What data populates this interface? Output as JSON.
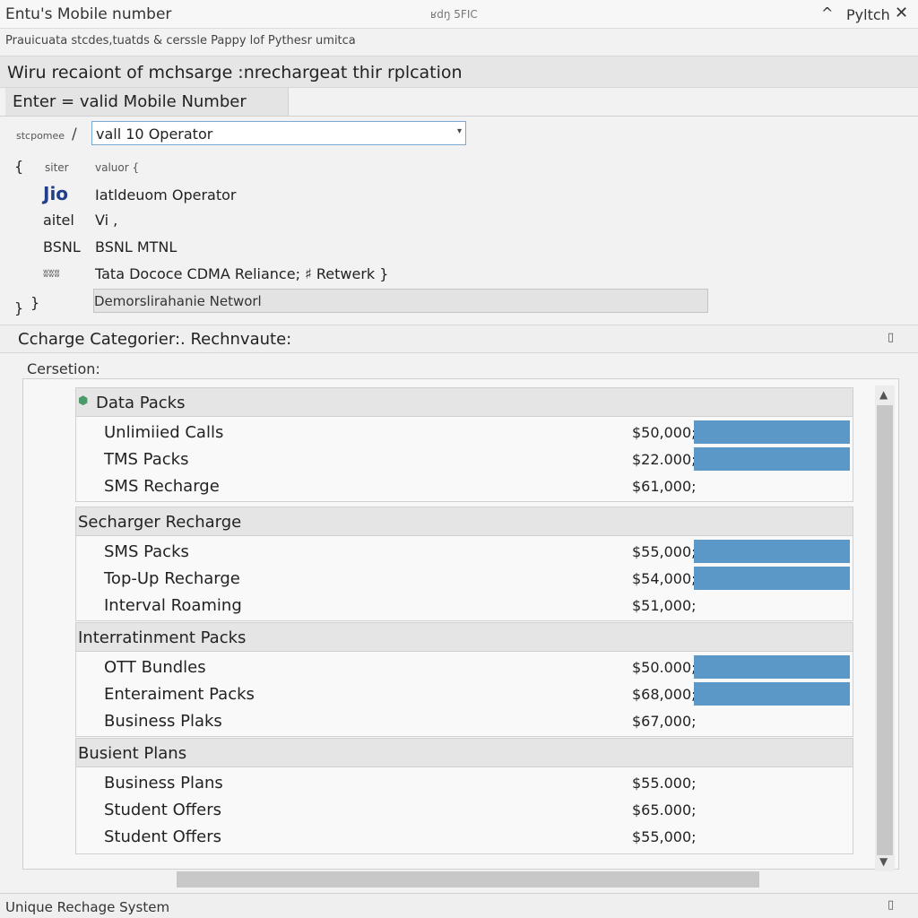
{
  "window": {
    "title": "Entu's Mobile number",
    "center_text": "ʁdŋ 5FIC",
    "minimize_glyph": "^",
    "app_name": "Pyltch",
    "close_glyph": "✕"
  },
  "subtitle": "Prauicuata stcdes,tuatds & cerssle Pappy lof Pythesr umitca",
  "heading": "Wiru recaiont of mchsarge :nrechargeat thir rplcation",
  "mobile_tab": "Enter = valid Mobile Number",
  "operator": {
    "label": "stcpomee",
    "slash": "/",
    "value": "vall 10 Operator",
    "caret": "▾"
  },
  "tree": {
    "open_brace": "{",
    "sub_open_left": "siter",
    "sub_open_right": "valuor {",
    "rows": [
      {
        "key": "Jio",
        "value": "Iatldeuom Operator"
      },
      {
        "key": "aitel",
        "value": "Vi ,"
      },
      {
        "key": "BSNL",
        "value": "BSNL MTNL"
      },
      {
        "key": "ʬʬʬ",
        "value": "Tata Dococe CDMA Reliance; ♯ Retwerk }"
      }
    ],
    "network_box": "Demorslirahanie Networl",
    "close_left": "}",
    "close_right": "}"
  },
  "category_header": "Ccharge Categorier:. Rechnvaute:",
  "section_label": "Cersetion:",
  "groups": [
    {
      "title": "Data Packs",
      "icon": "⬢",
      "items": [
        {
          "name": "Unlimiied Calls",
          "price": "$50,000;",
          "fill": 1
        },
        {
          "name": "TMS Packs",
          "price": "$22.000;",
          "fill": 1
        },
        {
          "name": "SMS Recharge",
          "price": "$61,000;",
          "fill": 0
        }
      ]
    },
    {
      "title": "Secharger Recharge",
      "icon": "",
      "items": [
        {
          "name": "SMS Packs",
          "price": "$55,000;",
          "fill": 1
        },
        {
          "name": "Top-Up Recharge",
          "price": "$54,000;",
          "fill": 1
        },
        {
          "name": "Interval Roaming",
          "price": "$51,000;",
          "fill": 0
        }
      ]
    },
    {
      "title": "Interratinment Packs",
      "icon": "",
      "items": [
        {
          "name": "OTT Bundles",
          "price": "$50.000;",
          "fill": 1
        },
        {
          "name": "Enteraiment Packs",
          "price": "$68,000;",
          "fill": 1
        },
        {
          "name": "Business Plaks",
          "price": "$67,000;",
          "fill": 0
        }
      ]
    },
    {
      "title": "Busient Plans",
      "icon": "",
      "items": [
        {
          "name": "Business Plans",
          "price": "$55.000;",
          "fill": 0
        },
        {
          "name": "Student Offers",
          "price": "$65.000;",
          "fill": 0
        },
        {
          "name": "Student Offers",
          "price": "$55,000;",
          "fill": 0
        }
      ]
    }
  ],
  "scroll": {
    "up": "▲",
    "down": "▼"
  },
  "status": "Unique Rechage System",
  "status_icon": "▯",
  "header_icon": "▯",
  "colors": {
    "bar": "#5b97c7",
    "select_border": "#7aa7d4",
    "brand": "#1f3f8c"
  }
}
